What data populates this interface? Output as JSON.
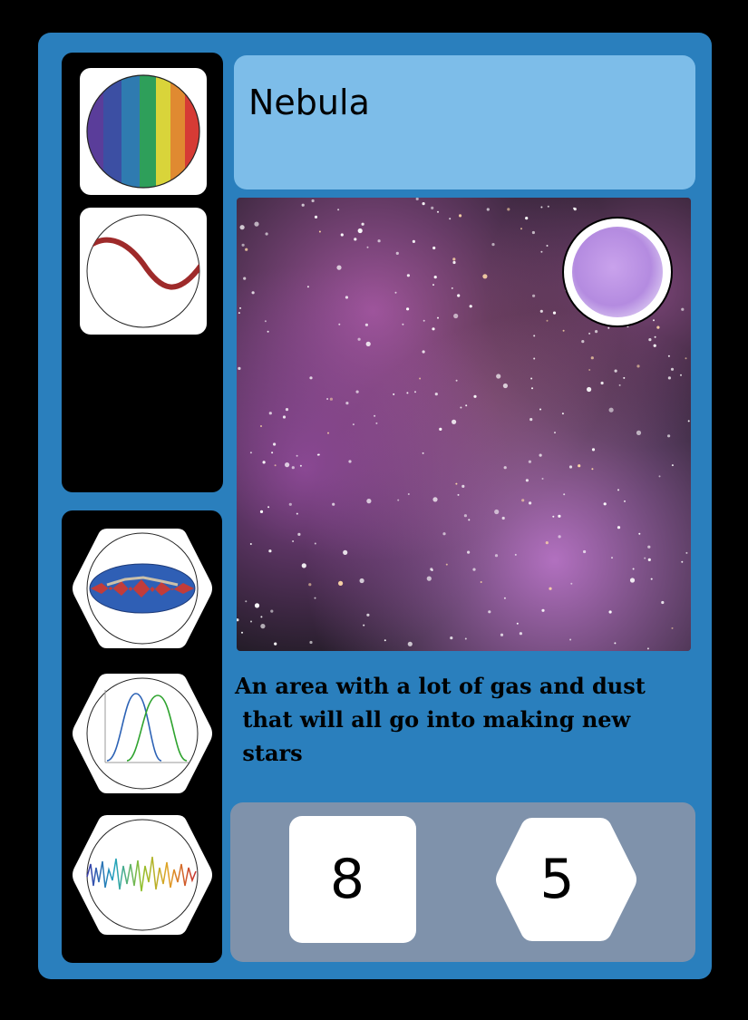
{
  "card": {
    "title": "Nebula",
    "description_lines": [
      "An area with a lot of gas and dust",
      " that will all go into making new",
      " stars"
    ],
    "stats": {
      "square_value": "8",
      "hex_value": "5"
    }
  },
  "icons": {
    "top": [
      "rainbow-spectrum-icon",
      "sine-wave-icon"
    ],
    "bottom": [
      "sky-map-icon",
      "distribution-curves-icon",
      "waveform-icon"
    ],
    "art_badge": "purple-sphere-icon"
  },
  "colors": {
    "card_border": "#000000",
    "card_background": "#2a7fbd",
    "title_background": "#7dbde9",
    "stats_background": "#7f92ab",
    "badge_color": "#b48be0"
  }
}
